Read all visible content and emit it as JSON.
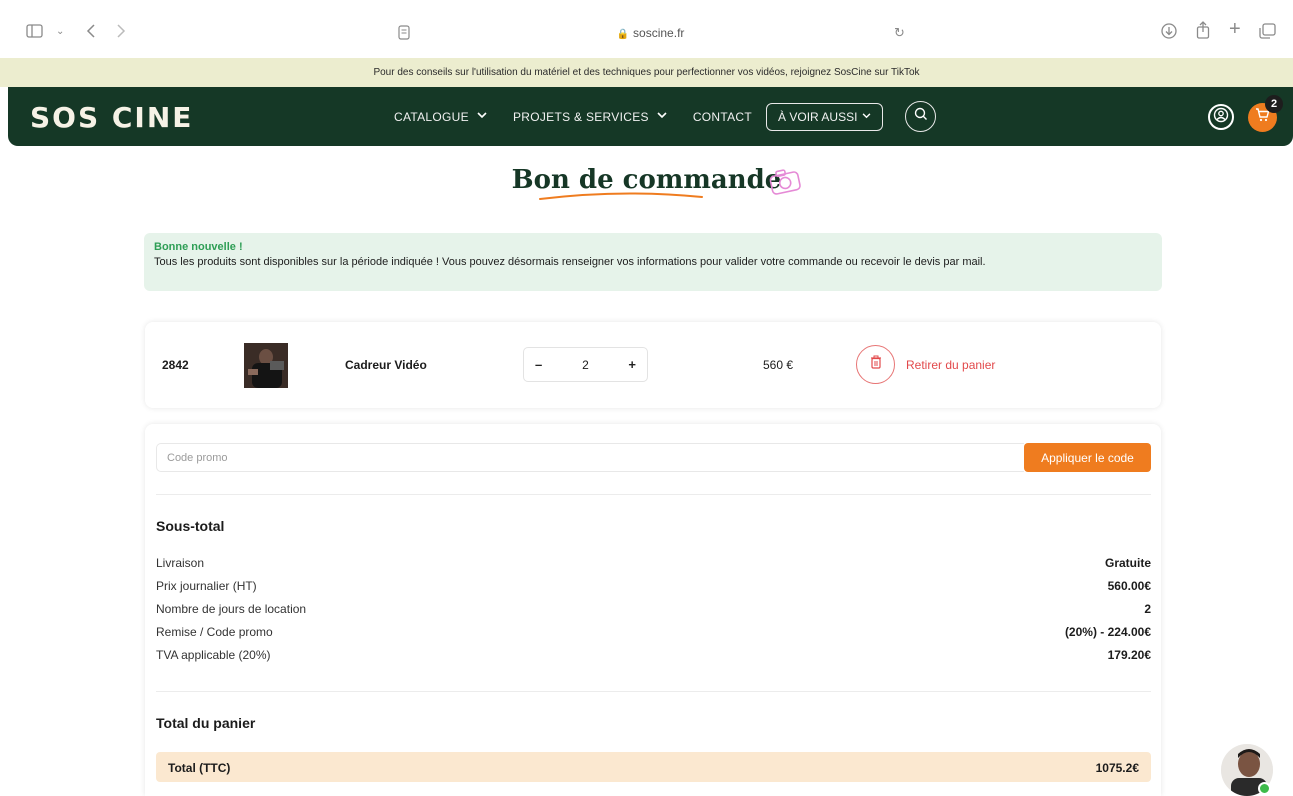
{
  "browser": {
    "url": "soscine.fr"
  },
  "announcement": "Pour des conseils sur l'utilisation du matériel et des techniques pour perfectionner vos vidéos, rejoignez SosCine sur TikTok",
  "nav": {
    "logo": "SOS CINE",
    "links": [
      "CATALOGUE",
      "PROJETS & SERVICES",
      "CONTACT"
    ],
    "see_also": "À VOIR AUSSI",
    "cart_count": "2"
  },
  "page": {
    "title": "Bon de commande"
  },
  "alert": {
    "title": "Bonne nouvelle !",
    "text": "Tous les produits sont disponibles sur la période indiquée ! Vous pouvez désormais renseigner vos informations pour valider votre commande ou recevoir le devis par mail."
  },
  "cart_item": {
    "id": "2842",
    "name": "Cadreur Vidéo",
    "quantity": "2",
    "price": "560 €",
    "remove_label": "Retirer du panier"
  },
  "promo": {
    "placeholder": "Code promo",
    "button": "Appliquer le code"
  },
  "summary": {
    "subtotal_title": "Sous-total",
    "rows": [
      {
        "label": "Livraison",
        "value": "Gratuite"
      },
      {
        "label": "Prix journalier (HT)",
        "value": "560.00€"
      },
      {
        "label": "Nombre de jours de location",
        "value": "2"
      },
      {
        "label": "Remise / Code promo",
        "value": "(20%) - 224.00€"
      },
      {
        "label": "TVA applicable (20%)",
        "value": "179.20€"
      }
    ],
    "total_title": "Total du panier",
    "total_label": "Total (TTC)",
    "total_value": "1075.2€"
  },
  "colors": {
    "nav_bg": "#153826",
    "accent": "#ef7c1f",
    "alert_bg": "#e6f3ea",
    "danger": "#e2494b"
  }
}
